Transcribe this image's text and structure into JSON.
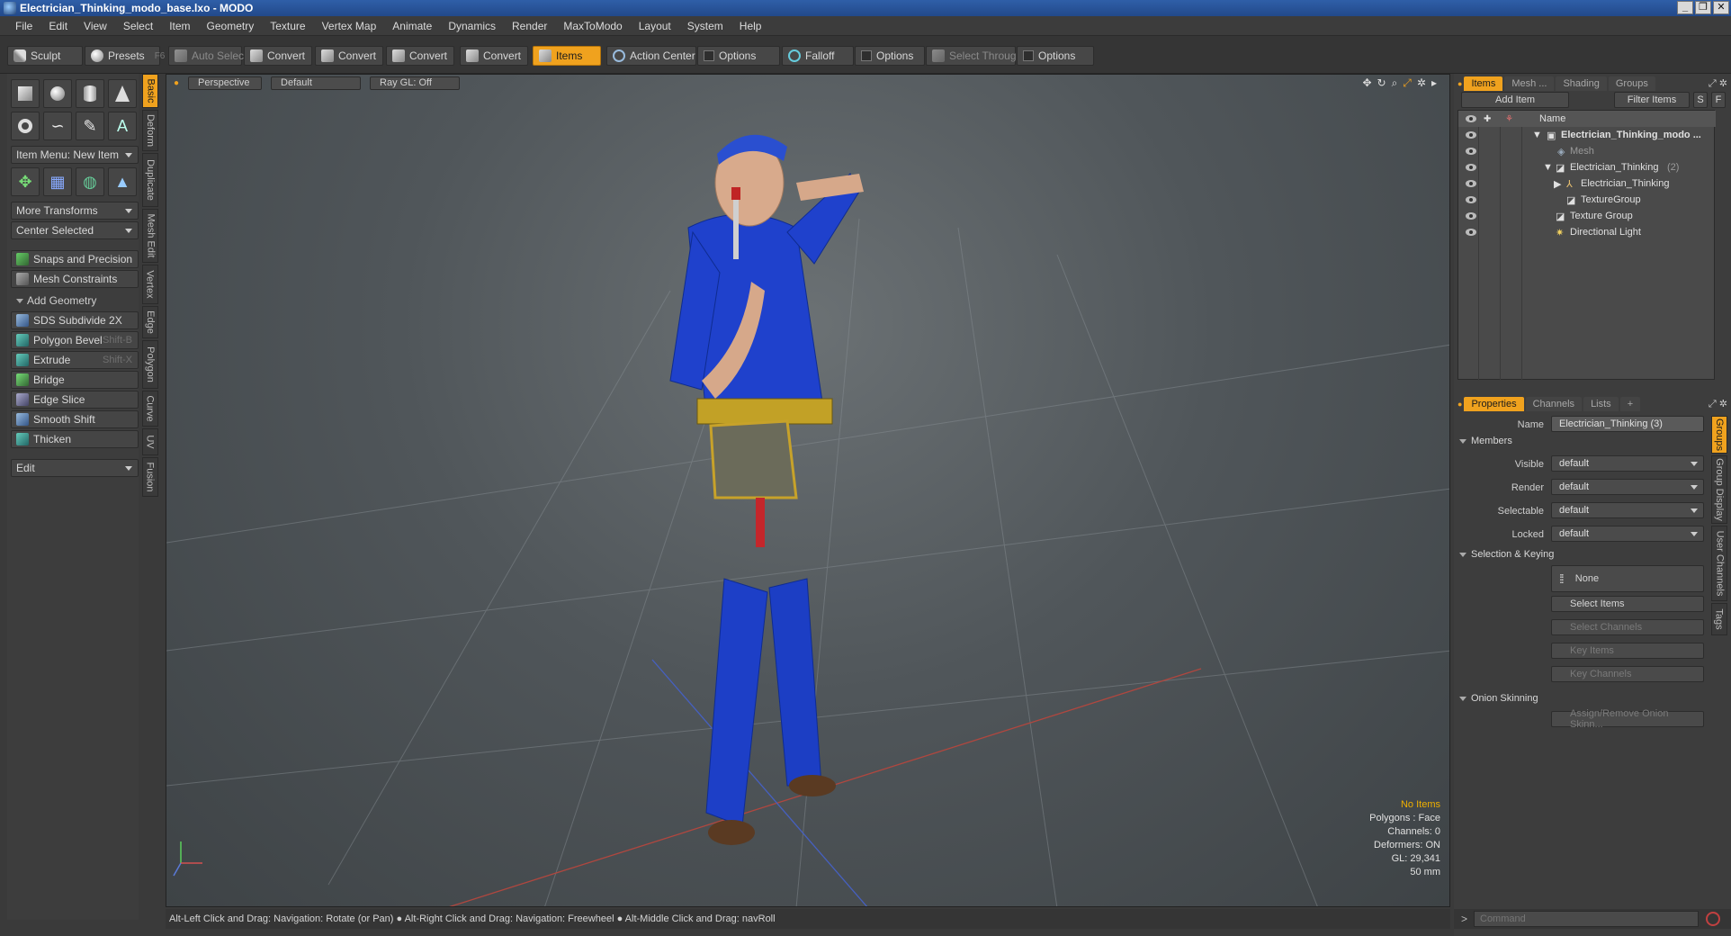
{
  "window": {
    "title": "Electrician_Thinking_modo_base.lxo - MODO",
    "controls": [
      "_",
      "❐",
      "✕"
    ]
  },
  "menubar": [
    "File",
    "Edit",
    "View",
    "Select",
    "Item",
    "Geometry",
    "Texture",
    "Vertex Map",
    "Animate",
    "Dynamics",
    "Render",
    "MaxToModo",
    "Layout",
    "System",
    "Help"
  ],
  "toolbar": {
    "sculpt": "Sculpt",
    "presets": "Presets",
    "presets_shortcut": "F6",
    "auto_select": "Auto Select",
    "convert1": "Convert",
    "convert2": "Convert",
    "convert3": "Convert",
    "convert4": "Convert",
    "items": "Items",
    "action_center": "Action Center",
    "options1": "Options",
    "falloff": "Falloff",
    "options2": "Options",
    "select_through": "Select Through",
    "options3": "Options"
  },
  "left_panel": {
    "item_menu": "Item Menu: New Item",
    "more_transforms": "More Transforms",
    "center_selected": "Center Selected",
    "snaps": "Snaps and Precision",
    "mesh_constraints": "Mesh Constraints",
    "add_geometry": "Add Geometry",
    "tools": [
      {
        "label": "SDS Subdivide 2X",
        "shortcut": ""
      },
      {
        "label": "Polygon Bevel",
        "shortcut": "Shift-B"
      },
      {
        "label": "Extrude",
        "shortcut": "Shift-X"
      },
      {
        "label": "Bridge",
        "shortcut": ""
      },
      {
        "label": "Edge Slice",
        "shortcut": ""
      },
      {
        "label": "Smooth Shift",
        "shortcut": ""
      },
      {
        "label": "Thicken",
        "shortcut": ""
      }
    ],
    "edit": "Edit",
    "vtabs": [
      "Basic",
      "Deform",
      "Duplicate",
      "Mesh Edit",
      "Vertex",
      "Edge",
      "Polygon",
      "Curve",
      "UV",
      "Fusion"
    ]
  },
  "viewport": {
    "view": "Perspective",
    "shading": "Default",
    "raygl": "Ray GL: Off",
    "info": {
      "selection": "No Items",
      "polygons": "Polygons : Face",
      "channels": "Channels: 0",
      "deformers": "Deformers: ON",
      "gl": "GL: 29,341",
      "focal": "50 mm"
    }
  },
  "statusbar": "Alt-Left Click and Drag: Navigation: Rotate (or Pan) ● Alt-Right Click and Drag: Navigation: Freewheel ● Alt-Middle Click and Drag: navRoll",
  "items_panel": {
    "tabs": [
      "Items",
      "Mesh ...",
      "Shading",
      "Groups"
    ],
    "add_item": "Add Item",
    "filter_items": "Filter Items",
    "s_btn": "S",
    "f_btn": "F",
    "name_col": "Name",
    "rows": [
      {
        "label": "Electrician_Thinking_modo ...",
        "indent": 0
      },
      {
        "label": "Mesh",
        "indent": 1
      },
      {
        "label": "Electrician_Thinking",
        "count": "(2)",
        "indent": 1
      },
      {
        "label": "Electrician_Thinking",
        "indent": 2
      },
      {
        "label": "TextureGroup",
        "indent": 2
      },
      {
        "label": "Texture Group",
        "indent": 1
      },
      {
        "label": "Directional Light",
        "indent": 1
      }
    ]
  },
  "properties_panel": {
    "tabs": [
      "Properties",
      "Channels",
      "Lists",
      "+"
    ],
    "name_label": "Name",
    "name_value": "Electrician_Thinking (3)",
    "members": "Members",
    "visible_label": "Visible",
    "visible_value": "default",
    "render_label": "Render",
    "render_value": "default",
    "selectable_label": "Selectable",
    "selectable_value": "default",
    "locked_label": "Locked",
    "locked_value": "default",
    "selection_keying": "Selection & Keying",
    "none_btn": "None",
    "select_items": "Select Items",
    "select_channels": "Select Channels",
    "key_items": "Key Items",
    "key_channels": "Key Channels",
    "onion_skinning": "Onion Skinning",
    "assign_onion": "Assign/Remove Onion Skinn...",
    "side_tabs": [
      "Groups",
      "Group Display",
      "User Channels",
      "Tags"
    ]
  },
  "command": {
    "prompt": ">",
    "placeholder": "Command"
  }
}
